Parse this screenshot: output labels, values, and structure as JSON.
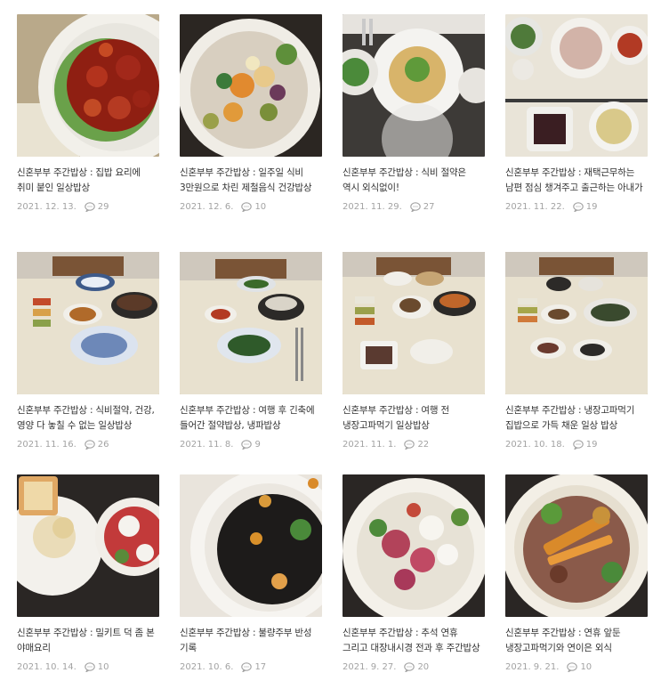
{
  "posts": [
    {
      "title": "신혼부부 주간밥상 : 집밥 요리에 취미 붙인 일상밥상",
      "date": "2021. 12. 13.",
      "comments": "29"
    },
    {
      "title": "신혼부부 주간밥상 : 일주일 식비 3만원으로 차린 제철음식 건강밥상",
      "date": "2021. 12. 6.",
      "comments": "10"
    },
    {
      "title": "신혼부부 주간밥상 : 식비 절약은 역시 외식없이!",
      "date": "2021. 11. 29.",
      "comments": "27"
    },
    {
      "title": "신혼부부 주간밥상 : 재택근무하는 남편 점심 챙겨주고 출근하는 아내가 차린 일상밥상",
      "date": "2021. 11. 22.",
      "comments": "19"
    },
    {
      "title": "신혼부부 주간밥상 : 식비절약, 건강, 영양 다 놓칠 수 없는 일상밥상",
      "date": "2021. 11. 16.",
      "comments": "26"
    },
    {
      "title": "신혼부부 주간밥상 : 여행 후 긴축에 들어간 절약밥상, 냉파밥상",
      "date": "2021. 11. 8.",
      "comments": "9"
    },
    {
      "title": "신혼부부 주간밥상 : 여행 전 냉장고파먹기 일상밥상",
      "date": "2021. 11. 1.",
      "comments": "22"
    },
    {
      "title": "신혼부부 주간밥상 : 냉장고파먹기 집밥으로 가득 채운 일상 밥상",
      "date": "2021. 10. 18.",
      "comments": "19"
    },
    {
      "title": "신혼부부 주간밥상 : 밀키트 덕 좀 본 야매요리",
      "date": "2021. 10. 14.",
      "comments": "10"
    },
    {
      "title": "신혼부부 주간밥상 : 불량주부 반성 기록",
      "date": "2021. 10. 6.",
      "comments": "17"
    },
    {
      "title": "신혼부부 주간밥상 : 추석 연휴 그리고 대장내시경 전과 후 주간밥상",
      "date": "2021. 9. 27.",
      "comments": "20"
    },
    {
      "title": "신혼부부 주간밥상 : 연휴 앞둔 냉장고파먹기와 연이은 외식",
      "date": "2021. 9. 21.",
      "comments": "10"
    }
  ],
  "icons": {
    "comment": "speech-bubble-icon"
  },
  "colors": {
    "meta": "#a3a3a3",
    "title": "#333333"
  }
}
